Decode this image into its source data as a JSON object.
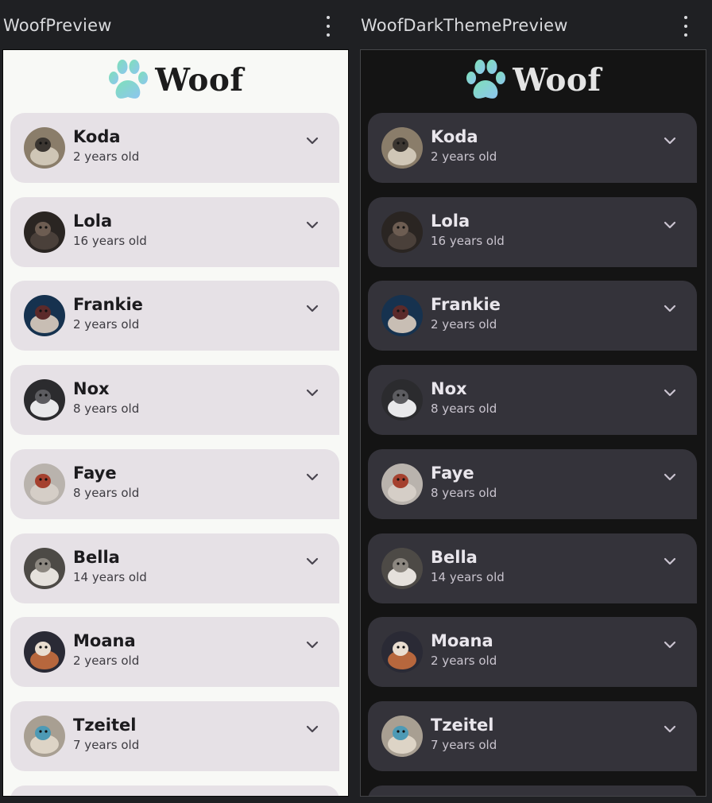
{
  "previews": [
    {
      "title": "WoofPreview",
      "theme": "light",
      "app_name": "Woof",
      "dogs": [
        {
          "name": "Koda",
          "age": "2 years old",
          "avatar": "koda-photo"
        },
        {
          "name": "Lola",
          "age": "16 years old",
          "avatar": "lola-photo"
        },
        {
          "name": "Frankie",
          "age": "2 years old",
          "avatar": "frankie-photo"
        },
        {
          "name": "Nox",
          "age": "8 years old",
          "avatar": "nox-photo"
        },
        {
          "name": "Faye",
          "age": "8 years old",
          "avatar": "faye-photo"
        },
        {
          "name": "Bella",
          "age": "14 years old",
          "avatar": "bella-photo"
        },
        {
          "name": "Moana",
          "age": "2 years old",
          "avatar": "moana-photo"
        },
        {
          "name": "Tzeitel",
          "age": "7 years old",
          "avatar": "tzeitel-photo"
        }
      ]
    },
    {
      "title": "WoofDarkThemePreview",
      "theme": "dark",
      "app_name": "Woof",
      "dogs": [
        {
          "name": "Koda",
          "age": "2 years old",
          "avatar": "koda-photo"
        },
        {
          "name": "Lola",
          "age": "16 years old",
          "avatar": "lola-photo"
        },
        {
          "name": "Frankie",
          "age": "2 years old",
          "avatar": "frankie-photo"
        },
        {
          "name": "Nox",
          "age": "8 years old",
          "avatar": "nox-photo"
        },
        {
          "name": "Faye",
          "age": "8 years old",
          "avatar": "faye-photo"
        },
        {
          "name": "Bella",
          "age": "14 years old",
          "avatar": "bella-photo"
        },
        {
          "name": "Moana",
          "age": "2 years old",
          "avatar": "moana-photo"
        },
        {
          "name": "Tzeitel",
          "age": "7 years old",
          "avatar": "tzeitel-photo"
        }
      ]
    }
  ],
  "icons": {
    "menu": "more-vert-icon",
    "expand": "chevron-down-icon",
    "logo": "paw-logo-icon"
  },
  "colors": {
    "ide_background": "#1f2023",
    "light_surface": "#f8f9f6",
    "light_card": "#e6e1e6",
    "dark_surface": "#141414",
    "dark_card": "#34333a",
    "paw_gradient_start": "#7ee0b8",
    "paw_gradient_end": "#8ec5f0"
  }
}
